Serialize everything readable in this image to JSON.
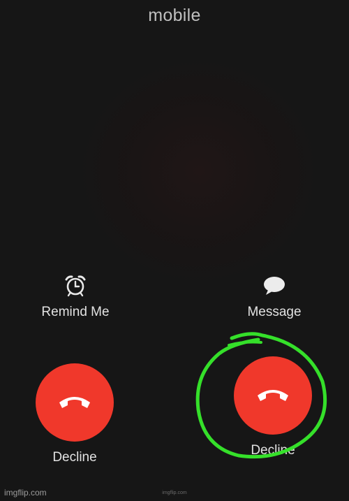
{
  "caller": {
    "label": "mobile"
  },
  "actions": {
    "remind": {
      "label": "Remind Me",
      "icon": "alarm-clock-icon"
    },
    "message": {
      "label": "Message",
      "icon": "speech-bubble-icon"
    }
  },
  "decline_buttons": [
    {
      "label": "Decline",
      "icon": "phone-hangup-icon"
    },
    {
      "label": "Decline",
      "icon": "phone-hangup-icon",
      "circled": true
    }
  ],
  "colors": {
    "background": "#161616",
    "decline": "#f0382b",
    "annotation": "#35e02a",
    "text": "#e2e2e2"
  },
  "footer": {
    "watermark": "imgflip.com",
    "credit": "imgflip.com"
  }
}
